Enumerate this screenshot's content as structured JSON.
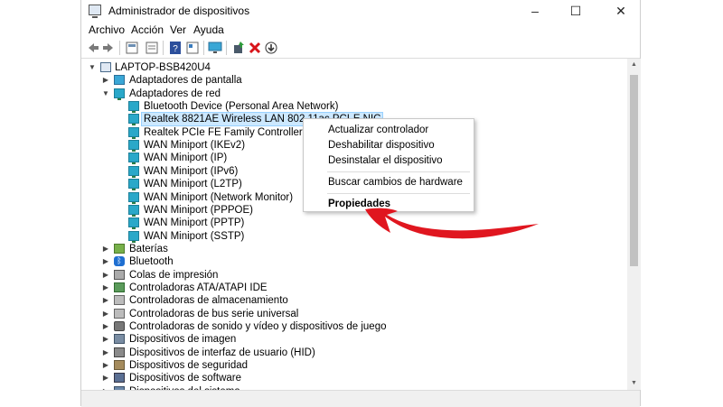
{
  "window": {
    "title": "Administrador de dispositivos",
    "controls": {
      "minimize": "–",
      "maximize": "☐",
      "close": "✕"
    }
  },
  "menu": [
    "Archivo",
    "Acción",
    "Ver",
    "Ayuda"
  ],
  "toolbar": [
    "back-icon",
    "forward-icon",
    "computer-view-icon",
    "properties-icon",
    "help-icon",
    "resources-icon",
    "monitor-icon",
    "enable-device-icon",
    "uninstall-icon",
    "update-driver-icon"
  ],
  "tree": {
    "root": "LAPTOP-BSB420U4",
    "items": [
      {
        "label": "Adaptadores de pantalla",
        "icon": "display-icon",
        "expanded": false
      },
      {
        "label": "Adaptadores de red",
        "icon": "network-icon",
        "expanded": true
      },
      {
        "label": "Bluetooth Device (Personal Area Network)",
        "icon": "network-icon",
        "child": true
      },
      {
        "label": "Realtek 8821AE Wireless LAN 802.11ac PCI-E NIC",
        "icon": "network-icon",
        "child": true,
        "selected": true
      },
      {
        "label": "Realtek PCIe FE Family Controller",
        "icon": "network-icon",
        "child": true
      },
      {
        "label": "WAN Miniport (IKEv2)",
        "icon": "network-icon",
        "child": true
      },
      {
        "label": "WAN Miniport (IP)",
        "icon": "network-icon",
        "child": true
      },
      {
        "label": "WAN Miniport (IPv6)",
        "icon": "network-icon",
        "child": true
      },
      {
        "label": "WAN Miniport (L2TP)",
        "icon": "network-icon",
        "child": true
      },
      {
        "label": "WAN Miniport (Network Monitor)",
        "icon": "network-icon",
        "child": true
      },
      {
        "label": "WAN Miniport (PPPOE)",
        "icon": "network-icon",
        "child": true
      },
      {
        "label": "WAN Miniport (PPTP)",
        "icon": "network-icon",
        "child": true
      },
      {
        "label": "WAN Miniport (SSTP)",
        "icon": "network-icon",
        "child": true
      },
      {
        "label": "Baterías",
        "icon": "battery-icon",
        "expanded": false
      },
      {
        "label": "Bluetooth",
        "icon": "bluetooth-icon",
        "expanded": false
      },
      {
        "label": "Colas de impresión",
        "icon": "print-queue-icon",
        "expanded": false
      },
      {
        "label": "Controladoras ATA/ATAPI IDE",
        "icon": "ata-controller-icon",
        "expanded": false
      },
      {
        "label": "Controladoras de almacenamiento",
        "icon": "storage-controller-icon",
        "expanded": false
      },
      {
        "label": "Controladoras de bus serie universal",
        "icon": "usb-controller-icon",
        "expanded": false
      },
      {
        "label": "Controladoras de sonido y vídeo y dispositivos de juego",
        "icon": "sound-icon",
        "expanded": false
      },
      {
        "label": "Dispositivos de imagen",
        "icon": "camera-icon",
        "expanded": false
      },
      {
        "label": "Dispositivos de interfaz de usuario (HID)",
        "icon": "hid-icon",
        "expanded": false
      },
      {
        "label": "Dispositivos de seguridad",
        "icon": "security-device-icon",
        "expanded": false
      },
      {
        "label": "Dispositivos de software",
        "icon": "software-device-icon",
        "expanded": false
      },
      {
        "label": "Dispositivos del sistema",
        "icon": "system-device-icon",
        "expanded": false
      }
    ]
  },
  "context_menu": {
    "items": [
      {
        "label": "Actualizar controlador"
      },
      {
        "label": "Deshabilitar dispositivo"
      },
      {
        "label": "Desinstalar el dispositivo"
      },
      {
        "separator": true
      },
      {
        "label": "Buscar cambios de hardware"
      },
      {
        "separator": true
      },
      {
        "label": "Propiedades",
        "bold": true
      }
    ]
  },
  "colors": {
    "selection": "#cce8ff",
    "annotation_arrow": "#e0161f"
  }
}
